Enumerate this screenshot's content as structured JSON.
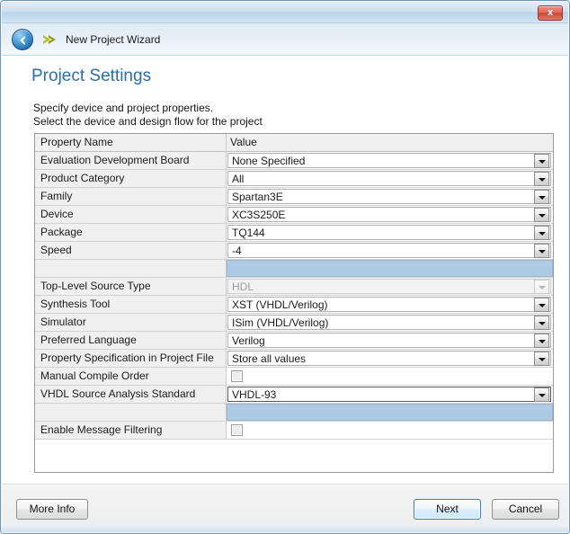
{
  "window": {
    "close_label": "x",
    "back_icon": "back-arrow-icon",
    "wizard_icon": "chevron-right-icon",
    "wizard_title": "New Project Wizard"
  },
  "page": {
    "title": "Project Settings",
    "subtitle_line_1": "Specify device and project properties.",
    "subtitle_line_2": "Select the device and design flow for the project"
  },
  "grid": {
    "columns": [
      "Property Name",
      "Value"
    ],
    "rows": [
      {
        "name": "Evaluation Development Board",
        "value": "None Specified",
        "type": "combo"
      },
      {
        "name": "Product Category",
        "value": "All",
        "type": "combo"
      },
      {
        "name": "Family",
        "value": "Spartan3E",
        "type": "combo"
      },
      {
        "name": "Device",
        "value": "XC3S250E",
        "type": "combo"
      },
      {
        "name": "Package",
        "value": "TQ144",
        "type": "combo"
      },
      {
        "name": "Speed",
        "value": "-4",
        "type": "combo"
      },
      {
        "name": "",
        "value": "",
        "type": "spacer"
      },
      {
        "name": "Top-Level Source Type",
        "value": "HDL",
        "type": "combo-disabled"
      },
      {
        "name": "Synthesis Tool",
        "value": "XST (VHDL/Verilog)",
        "type": "combo"
      },
      {
        "name": "Simulator",
        "value": "ISim (VHDL/Verilog)",
        "type": "combo"
      },
      {
        "name": "Preferred Language",
        "value": "Verilog",
        "type": "combo"
      },
      {
        "name": "Property Specification in Project File",
        "value": "Store all values",
        "type": "combo"
      },
      {
        "name": "Manual Compile Order",
        "value": "",
        "type": "checkbox"
      },
      {
        "name": "VHDL Source Analysis Standard",
        "value": "VHDL-93",
        "type": "combo-focused"
      },
      {
        "name": "",
        "value": "",
        "type": "spacer"
      },
      {
        "name": "Enable Message Filtering",
        "value": "",
        "type": "checkbox"
      }
    ]
  },
  "footer": {
    "more_info_label": "More Info",
    "next_label": "Next",
    "cancel_label": "Cancel"
  },
  "colors": {
    "title_blue": "#2b6ea8",
    "accent_blue": "#3c7fb1",
    "spacer_highlight": "#aecbe5",
    "close_red": "#cf4434"
  }
}
